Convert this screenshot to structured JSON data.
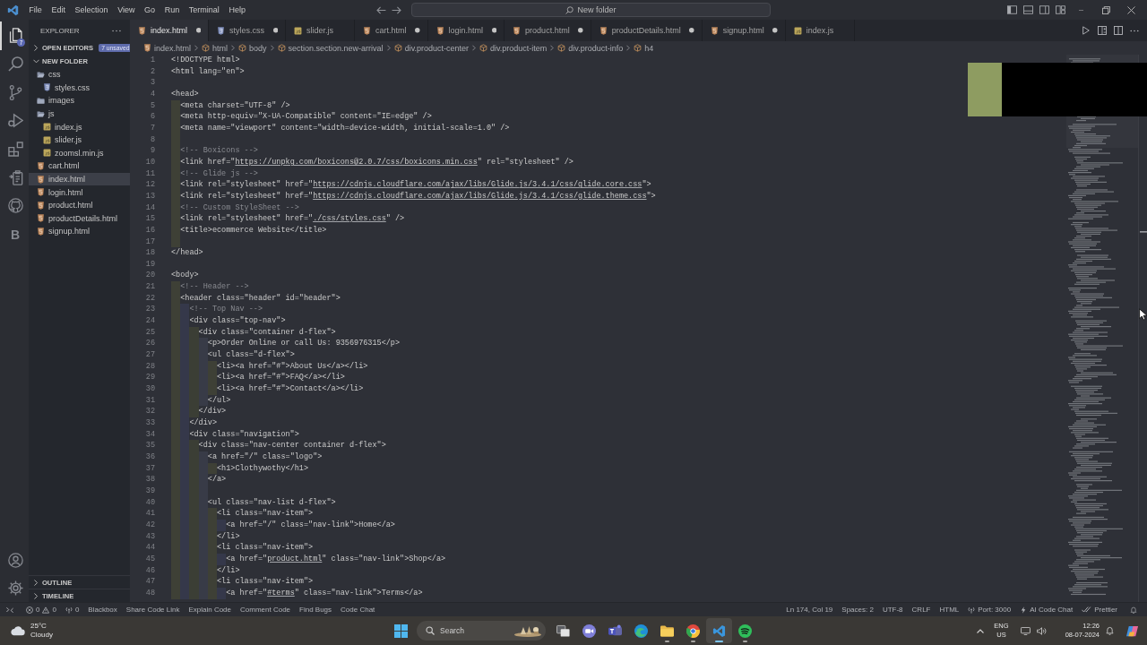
{
  "title_bar": {
    "menus": [
      "File",
      "Edit",
      "Selection",
      "View",
      "Go",
      "Run",
      "Terminal",
      "Help"
    ],
    "command_center": "New folder"
  },
  "activity_bar": {
    "items": [
      {
        "kind": "explorer",
        "selected": true,
        "badge": "7"
      },
      {
        "kind": "search",
        "selected": false
      },
      {
        "kind": "scm",
        "selected": false
      },
      {
        "kind": "debug",
        "selected": false
      },
      {
        "kind": "extensions",
        "selected": false
      },
      {
        "kind": "remote",
        "selected": false
      },
      {
        "kind": "github",
        "selected": false
      },
      {
        "kind": "letter",
        "label": "B",
        "selected": false
      }
    ],
    "bottom": [
      {
        "kind": "account"
      },
      {
        "kind": "settings"
      }
    ]
  },
  "sidebar": {
    "title": "EXPLORER",
    "open_editors": {
      "label": "OPEN EDITORS",
      "expanded": false,
      "badge": "7 unsaved"
    },
    "folder": {
      "label": "NEW FOLDER",
      "expanded": true,
      "items": [
        {
          "kind": "folder",
          "label": "css",
          "expanded": true,
          "selected": false,
          "children": [
            {
              "kind": "css",
              "label": "styles.css",
              "selected": false
            }
          ]
        },
        {
          "kind": "folder",
          "label": "images",
          "expanded": false,
          "selected": false
        },
        {
          "kind": "folder",
          "label": "js",
          "expanded": true,
          "selected": false,
          "children": [
            {
              "kind": "js",
              "label": "index.js",
              "selected": false
            },
            {
              "kind": "js",
              "label": "slider.js",
              "selected": false
            },
            {
              "kind": "js",
              "label": "zoomsl.min.js",
              "selected": false
            }
          ]
        },
        {
          "kind": "html",
          "label": "cart.html",
          "selected": false
        },
        {
          "kind": "html",
          "label": "index.html",
          "selected": true
        },
        {
          "kind": "html",
          "label": "login.html",
          "selected": false
        },
        {
          "kind": "html",
          "label": "product.html",
          "selected": false
        },
        {
          "kind": "html",
          "label": "productDetails.html",
          "selected": false
        },
        {
          "kind": "html",
          "label": "signup.html",
          "selected": false
        }
      ]
    },
    "panels": [
      {
        "label": "OUTLINE",
        "expanded": false
      },
      {
        "label": "TIMELINE",
        "expanded": false
      }
    ]
  },
  "tabs": [
    {
      "label": "index.html",
      "kind": "html",
      "selected": true,
      "modified": true
    },
    {
      "label": "styles.css",
      "kind": "css",
      "selected": false,
      "modified": true
    },
    {
      "label": "slider.js",
      "kind": "js",
      "selected": false,
      "modified": false
    },
    {
      "label": "cart.html",
      "kind": "html",
      "selected": false,
      "modified": true
    },
    {
      "label": "login.html",
      "kind": "html",
      "selected": false,
      "modified": true
    },
    {
      "label": "product.html",
      "kind": "html",
      "selected": false,
      "modified": true
    },
    {
      "label": "productDetails.html",
      "kind": "html",
      "selected": false,
      "modified": true
    },
    {
      "label": "signup.html",
      "kind": "html",
      "selected": false,
      "modified": true
    },
    {
      "label": "index.js",
      "kind": "js",
      "selected": false,
      "modified": false
    }
  ],
  "breadcrumb": [
    {
      "label": "index.html",
      "kind": "html"
    },
    {
      "label": "html",
      "kind": "element"
    },
    {
      "label": "body",
      "kind": "element"
    },
    {
      "label": "section.section.new-arrival",
      "kind": "element"
    },
    {
      "label": "div.product-center",
      "kind": "element"
    },
    {
      "label": "div.product-item",
      "kind": "element"
    },
    {
      "label": "div.product-info",
      "kind": "element"
    },
    {
      "label": "h4",
      "kind": "element"
    }
  ],
  "editor": {
    "lines": [
      {
        "number": "1",
        "kind": "code",
        "text": "<!DOCTYPE html>"
      },
      {
        "number": "2",
        "kind": "code",
        "text": "<html lang=\"en\">"
      },
      {
        "number": "3"
      },
      {
        "number": "4",
        "kind": "code",
        "text": "<head>"
      },
      {
        "number": "5",
        "kind": "code",
        "text": "  <meta charset=\"UTF-8\" />"
      },
      {
        "number": "6",
        "kind": "code",
        "text": "  <meta http-equiv=\"X-UA-Compatible\" content=\"IE=edge\" />"
      },
      {
        "number": "7",
        "kind": "code",
        "text": "  <meta name=\"viewport\" content=\"width=device-width, initial-scale=1.0\" />"
      },
      {
        "number": "8"
      },
      {
        "number": "9",
        "kind": "comment",
        "text": "  <!-- Boxicons -->"
      },
      {
        "number": "10",
        "kind": "code",
        "parts": [
          {
            "kind": "code",
            "text": "  <link href=\""
          },
          {
            "kind": "link",
            "text": "https://unpkg.com/boxicons@2.0.7/css/boxicons.min.css"
          },
          {
            "kind": "code",
            "text": "\" rel=\"stylesheet\" />"
          }
        ]
      },
      {
        "number": "11",
        "kind": "comment",
        "text": "  <!-- Glide js -->"
      },
      {
        "number": "12",
        "kind": "code",
        "parts": [
          {
            "kind": "code",
            "text": "  <link rel=\"stylesheet\" href=\""
          },
          {
            "kind": "link",
            "text": "https://cdnjs.cloudflare.com/ajax/libs/Glide.js/3.4.1/css/glide.core.css"
          },
          {
            "kind": "code",
            "text": "\">"
          }
        ]
      },
      {
        "number": "13",
        "kind": "code",
        "parts": [
          {
            "kind": "code",
            "text": "  <link rel=\"stylesheet\" href=\""
          },
          {
            "kind": "link",
            "text": "https://cdnjs.cloudflare.com/ajax/libs/Glide.js/3.4.1/css/glide.theme.css"
          },
          {
            "kind": "code",
            "text": "\">"
          }
        ]
      },
      {
        "number": "14",
        "kind": "comment",
        "text": "  <!-- Custom StyleSheet -->"
      },
      {
        "number": "15",
        "kind": "code",
        "parts": [
          {
            "kind": "code",
            "text": "  <link rel=\"stylesheet\" href=\""
          },
          {
            "kind": "link",
            "text": "./css/styles.css"
          },
          {
            "kind": "code",
            "text": "\" />"
          }
        ]
      },
      {
        "number": "16",
        "kind": "code",
        "text": "  <title>ecommerce Website</title>"
      },
      {
        "number": "17"
      },
      {
        "number": "18",
        "kind": "code",
        "text": "</head>"
      },
      {
        "number": "19"
      },
      {
        "number": "20",
        "kind": "code",
        "text": "<body>"
      },
      {
        "number": "21",
        "kind": "comment",
        "text": "  <!-- Header -->"
      },
      {
        "number": "22",
        "kind": "code",
        "text": "  <header class=\"header\" id=\"header\">"
      },
      {
        "number": "23",
        "kind": "comment",
        "text": "    <!-- Top Nav -->"
      },
      {
        "number": "24",
        "kind": "code",
        "text": "    <div class=\"top-nav\">"
      },
      {
        "number": "25",
        "kind": "code",
        "text": "      <div class=\"container d-flex\">"
      },
      {
        "number": "26",
        "kind": "code",
        "text": "        <p>Order Online or call Us: 9356976315</p>"
      },
      {
        "number": "27",
        "kind": "code",
        "text": "        <ul class=\"d-flex\">"
      },
      {
        "number": "28",
        "kind": "code",
        "text": "          <li><a href=\"#\">About Us</a></li>"
      },
      {
        "number": "29",
        "kind": "code",
        "text": "          <li><a href=\"#\">FAQ</a></li>"
      },
      {
        "number": "30",
        "kind": "code",
        "text": "          <li><a href=\"#\">Contact</a></li>"
      },
      {
        "number": "31",
        "kind": "code",
        "text": "        </ul>"
      },
      {
        "number": "32",
        "kind": "code",
        "text": "      </div>"
      },
      {
        "number": "33",
        "kind": "code",
        "text": "    </div>"
      },
      {
        "number": "34",
        "kind": "code",
        "text": "    <div class=\"navigation\">"
      },
      {
        "number": "35",
        "kind": "code",
        "text": "      <div class=\"nav-center container d-flex\">"
      },
      {
        "number": "36",
        "kind": "code",
        "text": "        <a href=\"/\" class=\"logo\">"
      },
      {
        "number": "37",
        "kind": "code",
        "text": "          <h1>Clothywothy</h1>"
      },
      {
        "number": "38",
        "kind": "code",
        "text": "        </a>"
      },
      {
        "number": "39"
      },
      {
        "number": "40",
        "kind": "code",
        "text": "        <ul class=\"nav-list d-flex\">"
      },
      {
        "number": "41",
        "kind": "code",
        "text": "          <li class=\"nav-item\">"
      },
      {
        "number": "42",
        "kind": "code",
        "text": "            <a href=\"/\" class=\"nav-link\">Home</a>"
      },
      {
        "number": "43",
        "kind": "code",
        "text": "          </li>"
      },
      {
        "number": "44",
        "kind": "code",
        "text": "          <li class=\"nav-item\">"
      },
      {
        "number": "45",
        "kind": "code",
        "parts": [
          {
            "kind": "code",
            "text": "            <a href=\""
          },
          {
            "kind": "link",
            "text": "product.html"
          },
          {
            "kind": "code",
            "text": "\" class=\"nav-link\">Shop</a>"
          }
        ]
      },
      {
        "number": "46",
        "kind": "code",
        "text": "          </li>"
      },
      {
        "number": "47",
        "kind": "code",
        "text": "          <li class=\"nav-item\">"
      },
      {
        "number": "48",
        "kind": "code",
        "parts": [
          {
            "kind": "code",
            "text": "            <a href=\""
          },
          {
            "kind": "link",
            "text": "#terms"
          },
          {
            "kind": "code",
            "text": "\" class=\"nav-link\">Terms</a>"
          }
        ]
      }
    ]
  },
  "status_bar": {
    "left": [
      {
        "kind": "remote"
      },
      {
        "kind": "problems",
        "errors": "0",
        "warnings": "0"
      },
      {
        "kind": "ports",
        "text": "0"
      },
      {
        "kind": "text",
        "text": "Blackbox"
      },
      {
        "kind": "text",
        "text": "Share Code Link"
      },
      {
        "kind": "text",
        "text": "Explain Code"
      },
      {
        "kind": "text",
        "text": "Comment Code"
      },
      {
        "kind": "text",
        "text": "Find Bugs"
      },
      {
        "kind": "text",
        "text": "Code Chat"
      }
    ],
    "right": [
      {
        "kind": "text",
        "text": "Ln 174, Col 19"
      },
      {
        "kind": "text",
        "text": "Spaces: 2"
      },
      {
        "kind": "text",
        "text": "UTF-8"
      },
      {
        "kind": "text",
        "text": "CRLF"
      },
      {
        "kind": "text",
        "text": "HTML"
      },
      {
        "kind": "server",
        "text": "Port: 3000"
      },
      {
        "kind": "chat",
        "text": "AI Code Chat"
      },
      {
        "kind": "prettier",
        "text": "Prettier"
      }
    ]
  },
  "taskbar": {
    "weather": {
      "temperature": "25°C",
      "condition": "Cloudy"
    },
    "search": {
      "placeholder": "Search"
    },
    "apps": [
      {
        "kind": "taskview",
        "running": false,
        "selected": false
      },
      {
        "kind": "meet",
        "running": false,
        "selected": false
      },
      {
        "kind": "teams",
        "running": false,
        "selected": false
      },
      {
        "kind": "edge",
        "running": false,
        "selected": false
      },
      {
        "kind": "files",
        "running": true,
        "selected": false
      },
      {
        "kind": "chrome",
        "running": true,
        "selected": false
      },
      {
        "kind": "vscode",
        "running": true,
        "selected": true
      },
      {
        "kind": "spotify",
        "running": true,
        "selected": false
      }
    ],
    "tray": {
      "language": "ENG",
      "region": "US",
      "time": "12:26",
      "date": "08-07-2024"
    }
  }
}
